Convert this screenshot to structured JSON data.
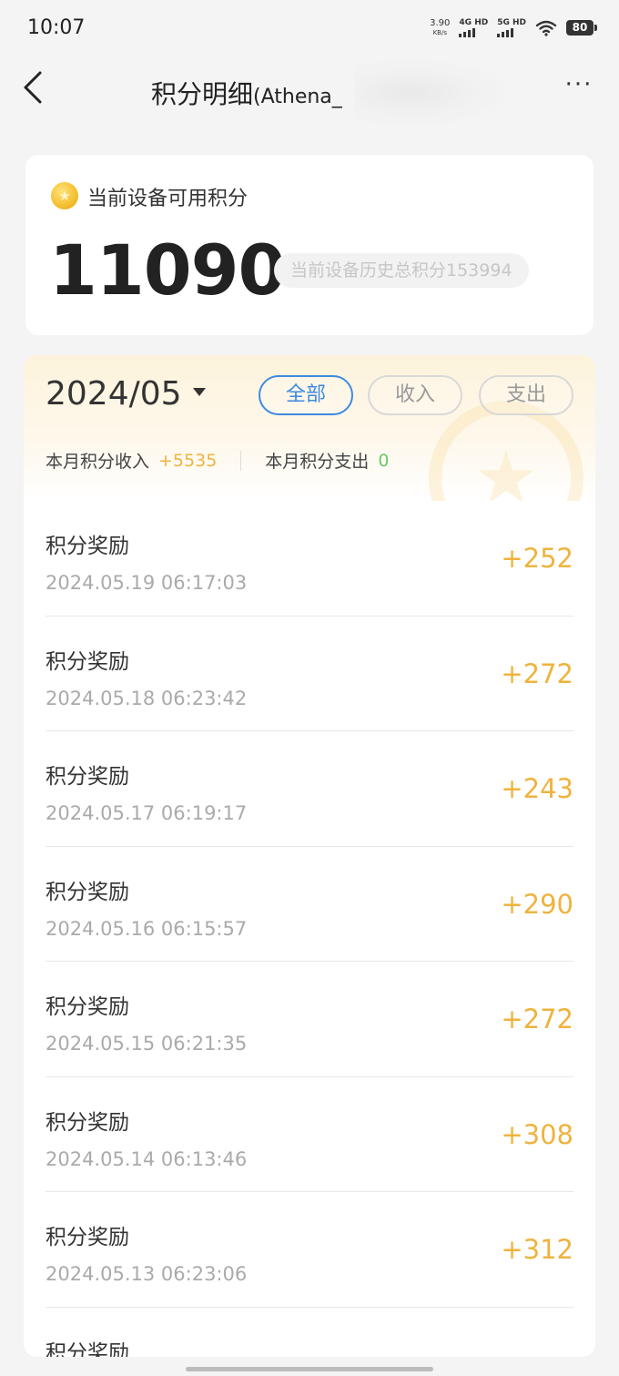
{
  "status_bar": {
    "time": "10:07",
    "net_speed": "3.90",
    "net_unit": "KB/s",
    "sim1": "4G HD",
    "sim2": "5G HD",
    "battery": "80"
  },
  "nav": {
    "title": "积分明细",
    "subtitle": "(Athena_"
  },
  "balance": {
    "label": "当前设备可用积分",
    "value": "11090",
    "history": "当前设备历史总积分153994"
  },
  "filter": {
    "month": "2024/05",
    "tabs": [
      {
        "label": "全部",
        "active": true
      },
      {
        "label": "收入",
        "active": false
      },
      {
        "label": "支出",
        "active": false
      }
    ]
  },
  "summary": {
    "income_label": "本月积分收入",
    "income_value": "+5535",
    "expense_label": "本月积分支出",
    "expense_value": "0"
  },
  "records": [
    {
      "title": "积分奖励",
      "time": "2024.05.19 06:17:03",
      "amount": "+252"
    },
    {
      "title": "积分奖励",
      "time": "2024.05.18 06:23:42",
      "amount": "+272"
    },
    {
      "title": "积分奖励",
      "time": "2024.05.17 06:19:17",
      "amount": "+243"
    },
    {
      "title": "积分奖励",
      "time": "2024.05.16 06:15:57",
      "amount": "+290"
    },
    {
      "title": "积分奖励",
      "time": "2024.05.15 06:21:35",
      "amount": "+272"
    },
    {
      "title": "积分奖励",
      "time": "2024.05.14 06:13:46",
      "amount": "+308"
    },
    {
      "title": "积分奖励",
      "time": "2024.05.13 06:23:06",
      "amount": "+312"
    },
    {
      "title": "积分奖励",
      "time": "",
      "amount": ""
    }
  ],
  "colors": {
    "accent_blue": "#3d8ae0",
    "income_orange": "#efb33d",
    "expense_green": "#6ac86a"
  }
}
